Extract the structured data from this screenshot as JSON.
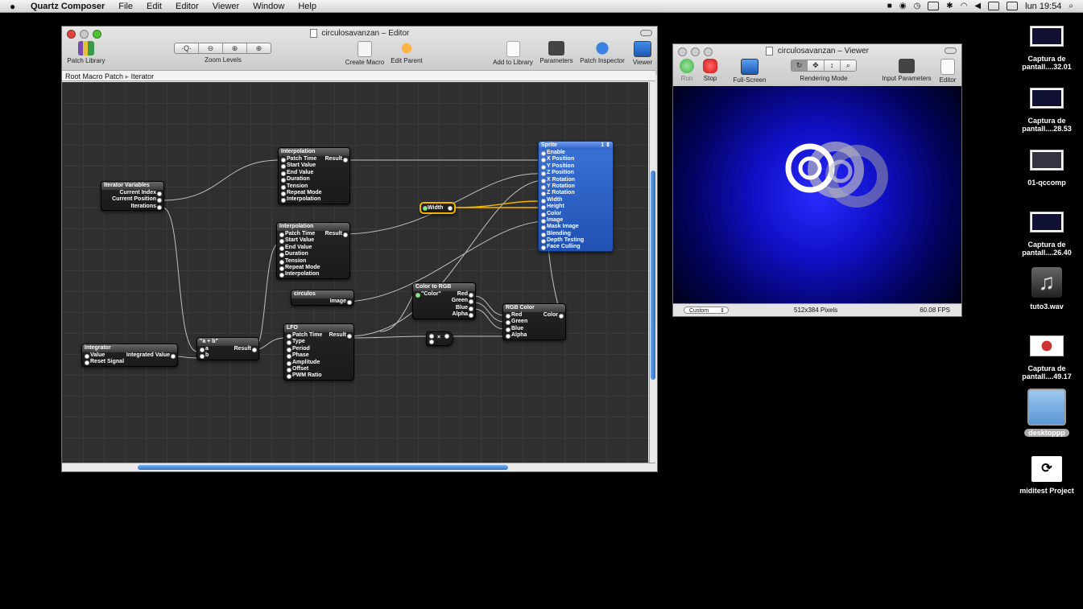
{
  "menubar": {
    "items": [
      "Quartz Composer",
      "File",
      "Edit",
      "Editor",
      "Viewer",
      "Window",
      "Help"
    ],
    "clock": "lun 19:54"
  },
  "editor": {
    "title": "circulosavanzan – Editor",
    "toolbar": {
      "patch_library": "Patch Library",
      "zoom_levels": "Zoom Levels",
      "create_macro": "Create Macro",
      "edit_parent": "Edit Parent",
      "add_to_library": "Add to Library",
      "parameters": "Parameters",
      "patch_inspector": "Patch Inspector",
      "viewer": "Viewer"
    },
    "breadcrumb": [
      "Root Macro Patch",
      "Iterator"
    ],
    "patches": {
      "iterator_vars": {
        "title": "Iterator Variables",
        "outputs": [
          "Current Index",
          "Current Position",
          "Iterations"
        ]
      },
      "interp1": {
        "title": "Interpolation",
        "inputs": [
          "Patch Time",
          "Start Value",
          "End Value",
          "Duration",
          "Tension",
          "Repeat Mode",
          "Interpolation"
        ],
        "output": "Result"
      },
      "interp2": {
        "title": "Interpolation",
        "inputs": [
          "Patch Time",
          "Start Value",
          "End Value",
          "Duration",
          "Tension",
          "Repeat Mode",
          "Interpolation"
        ],
        "output": "Result"
      },
      "circulos": {
        "title": "circulos",
        "output": "Image"
      },
      "width": {
        "title": "Width"
      },
      "sprite": {
        "title": "Sprite",
        "badge": "1 ⇕",
        "inputs": [
          "Enable",
          "X Position",
          "Y Position",
          "Z Position",
          "X Rotation",
          "Y Rotation",
          "Z Rotation",
          "Width",
          "Height",
          "Color",
          "Image",
          "Mask Image",
          "Blending",
          "Depth Testing",
          "Face Culling"
        ]
      },
      "color_to_rgb": {
        "title": "Color to RGB",
        "input": "\"Color\"",
        "outputs": [
          "Red",
          "Green",
          "Blue",
          "Alpha"
        ]
      },
      "rgb_color": {
        "title": "RGB Color",
        "inputs": [
          "Red",
          "Green",
          "Blue",
          "Alpha"
        ],
        "output": "Color"
      },
      "integrator": {
        "title": "Integrator",
        "inputs": [
          "Value",
          "Reset Signal"
        ],
        "output": "Integrated Value"
      },
      "a_plus_b": {
        "title": "\"a + b\"",
        "inputs": [
          "a",
          "b"
        ],
        "output": "Result"
      },
      "lfo": {
        "title": "LFO",
        "inputs": [
          "Patch Time",
          "Type",
          "Period",
          "Phase",
          "Amplitude",
          "Offset",
          "PWM Ratio"
        ],
        "output": "Result"
      },
      "multiply": {
        "title": "×"
      }
    }
  },
  "viewer": {
    "title": "circulosavanzan – Viewer",
    "toolbar": {
      "run": "Run",
      "stop": "Stop",
      "full_screen": "Full-Screen",
      "rendering_mode": "Rendering Mode",
      "input_parameters": "Input Parameters",
      "editor": "Editor"
    },
    "status": {
      "size_preset": "Custom",
      "resolution": "512x384 Pixels",
      "fps": "60.08 FPS"
    }
  },
  "desktop": [
    {
      "label1": "Captura de",
      "label2": "pantall....32.01"
    },
    {
      "label1": "Captura de",
      "label2": "pantall....28.53"
    },
    {
      "label1": "01-qccomp",
      "label2": ""
    },
    {
      "label1": "Captura de",
      "label2": "pantall....26.40"
    },
    {
      "label1": "tuto3.wav",
      "label2": ""
    },
    {
      "label1": "Captura de",
      "label2": "pantall....49.17"
    },
    {
      "label1": "desktoppp",
      "label2": ""
    },
    {
      "label1": "miditest Project",
      "label2": ""
    }
  ],
  "colors": {
    "accent": "#2f6fc7",
    "sprite_blue": "#2555c0",
    "run_green": "#3cb043",
    "stop_red": "#e02020",
    "selection_yellow": "#f0b400"
  }
}
